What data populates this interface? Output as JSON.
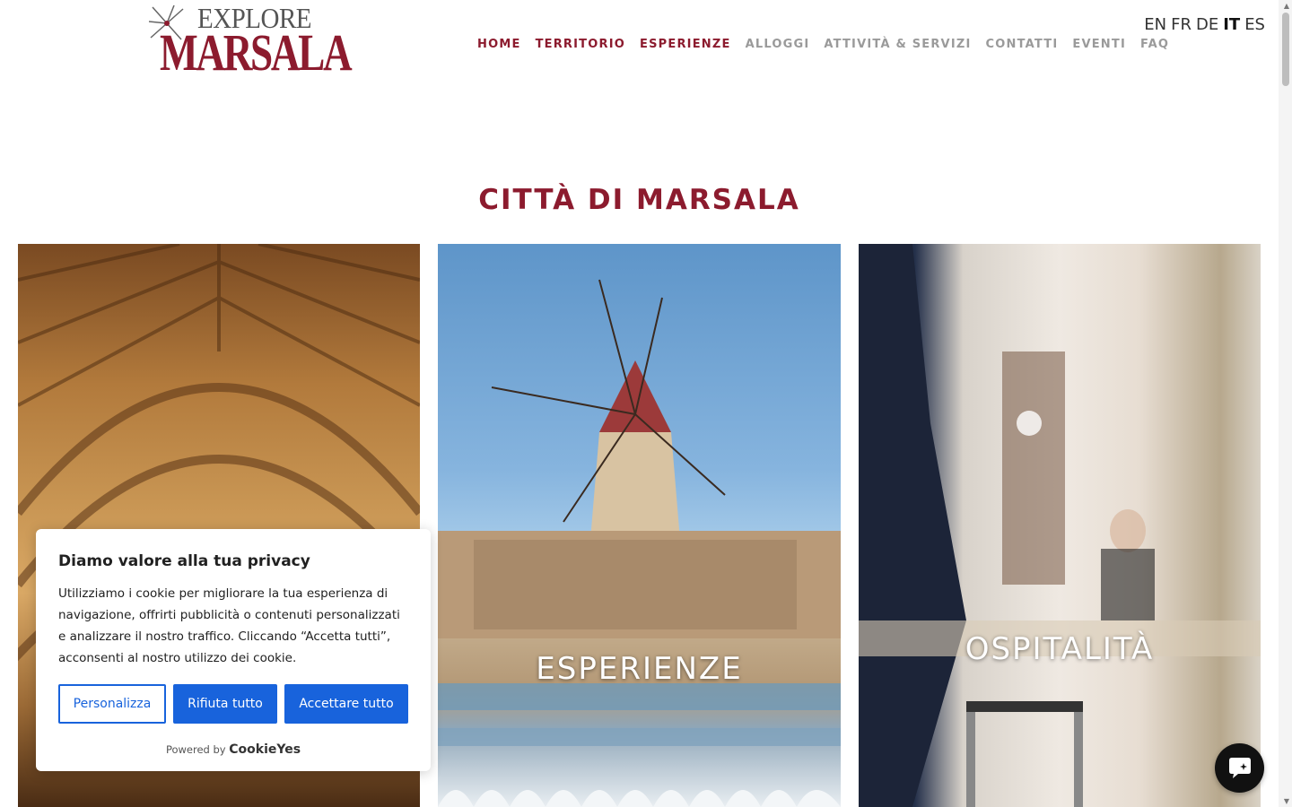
{
  "logo": {
    "top_text": "EXPLORE",
    "main_text": "MARSALA"
  },
  "nav": {
    "items": [
      {
        "label": "HOME",
        "active": true
      },
      {
        "label": "TERRITORIO",
        "active": true
      },
      {
        "label": "ESPERIENZE",
        "active": true
      },
      {
        "label": "ALLOGGI",
        "active": false
      },
      {
        "label": "ATTIVITÀ & SERVIZI",
        "active": false
      },
      {
        "label": "CONTATTI",
        "active": false
      },
      {
        "label": "EVENTI",
        "active": false
      },
      {
        "label": "FAQ",
        "active": false
      }
    ]
  },
  "languages": {
    "items": [
      "EN",
      "FR",
      "DE",
      "IT",
      "ES"
    ],
    "current": "IT"
  },
  "page_title": "CITTÀ DI MARSALA",
  "cards": [
    {
      "label": ""
    },
    {
      "label": "ESPERIENZE"
    },
    {
      "label": "OSPITALITÀ"
    }
  ],
  "cookie": {
    "title": "Diamo valore alla tua privacy",
    "text": "Utilizziamo i cookie per migliorare la tua esperienza di navigazione, offrirti pubblicità o contenuti personalizzati e analizzare il nostro traffico. Cliccando “Accetta tutti”, acconsenti al nostro utilizzo dei cookie.",
    "btn_customize": "Personalizza",
    "btn_reject": "Rifiuta tutto",
    "btn_accept": "Accettare tutto",
    "powered_by": "Powered by",
    "brand": "CookieYes"
  },
  "colors": {
    "brand": "#8c1b2e",
    "cookie_blue": "#1863dc",
    "nav_inactive": "#9a9a9a"
  },
  "icons": {
    "logo": "windmill-icon",
    "chat": "chat-icon"
  }
}
